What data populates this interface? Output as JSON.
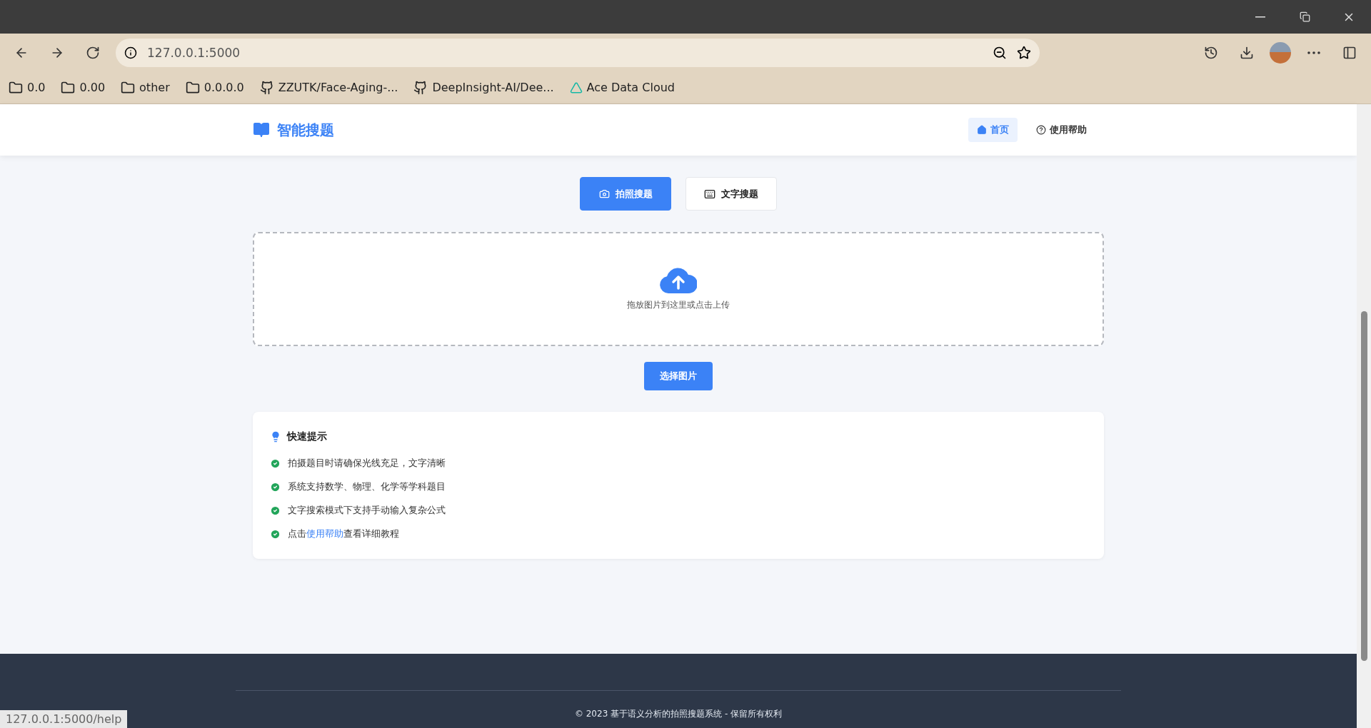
{
  "browser": {
    "url": "127.0.0.1:5000",
    "bookmarks": [
      {
        "kind": "folder",
        "label": "0.0"
      },
      {
        "kind": "folder",
        "label": "0.00"
      },
      {
        "kind": "folder",
        "label": "other"
      },
      {
        "kind": "folder",
        "label": "0.0.0.0"
      },
      {
        "kind": "github",
        "label": "ZZUTK/Face-Aging-..."
      },
      {
        "kind": "github",
        "label": "DeepInsight-AI/Dee..."
      },
      {
        "kind": "site",
        "label": "Ace Data Cloud"
      }
    ],
    "status_url": "127.0.0.1:5000/help"
  },
  "header": {
    "brand": "智能搜题",
    "nav": [
      {
        "label": "首页",
        "kind": "home",
        "selected": true
      },
      {
        "label": "使用帮助",
        "kind": "help",
        "selected": false
      }
    ]
  },
  "modes": [
    {
      "label": "拍照搜题",
      "kind": "camera",
      "selected": true
    },
    {
      "label": "文字搜题",
      "kind": "keyboard",
      "selected": false
    }
  ],
  "upload": {
    "hint": "拖放图片到这里或点击上传",
    "button": "选择图片"
  },
  "tips": {
    "title": "快速提示",
    "items": [
      {
        "text": "拍摄题目时请确保光线充足，文字清晰"
      },
      {
        "text": "系统支持数学、物理、化学等学科题目"
      },
      {
        "text": "文字搜索模式下支持手动输入复杂公式"
      },
      {
        "text": "点击",
        "link": "使用帮助",
        "after": "查看详细教程"
      }
    ]
  },
  "footer": {
    "copyright": "© 2023 基于语义分析的拍照搜题系统 - 保留所有权利"
  }
}
